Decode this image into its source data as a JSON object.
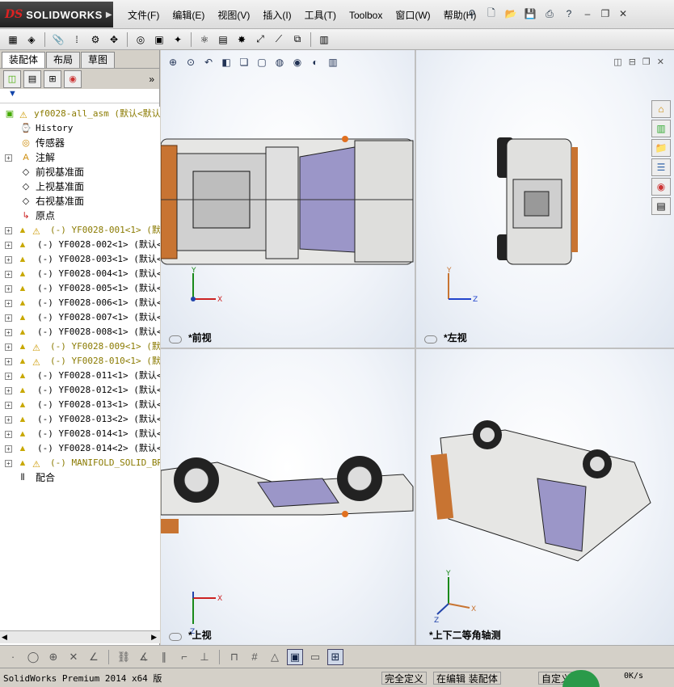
{
  "app": {
    "logo_prefix": "DS",
    "logo_name": "SOLIDWORKS"
  },
  "menu": [
    "文件(F)",
    "编辑(E)",
    "视图(V)",
    "插入(I)",
    "工具(T)",
    "Toolbox",
    "窗口(W)",
    "帮助(H)"
  ],
  "tabs": [
    "装配体",
    "布局",
    "草图"
  ],
  "tree": {
    "root": "yf0028-all_asm  (默认<默认",
    "items": [
      {
        "label": "History",
        "type": "folder"
      },
      {
        "label": "传感器",
        "type": "folder"
      },
      {
        "label": "注解",
        "type": "folder"
      },
      {
        "label": "前视基准面",
        "type": "plane"
      },
      {
        "label": "上视基准面",
        "type": "plane"
      },
      {
        "label": "右视基准面",
        "type": "plane"
      },
      {
        "label": "原点",
        "type": "origin"
      }
    ],
    "components": [
      {
        "label": "(-) YF0028-001<1> (默认",
        "warn": true
      },
      {
        "label": "(-) YF0028-002<1> (默认<<",
        "warn": false
      },
      {
        "label": "(-) YF0028-003<1> (默认<<",
        "warn": false
      },
      {
        "label": "(-) YF0028-004<1> (默认<<",
        "warn": false
      },
      {
        "label": "(-) YF0028-005<1> (默认<<",
        "warn": false
      },
      {
        "label": "(-) YF0028-006<1> (默认<<",
        "warn": false
      },
      {
        "label": "(-) YF0028-007<1> (默认<<",
        "warn": false
      },
      {
        "label": "(-) YF0028-008<1> (默认<<",
        "warn": false
      },
      {
        "label": "(-) YF0028-009<1> (默认",
        "warn": true
      },
      {
        "label": "(-) YF0028-010<1> (默认",
        "warn": true
      },
      {
        "label": "(-) YF0028-011<1> (默认<<",
        "warn": false
      },
      {
        "label": "(-) YF0028-012<1> (默认<<",
        "warn": false
      },
      {
        "label": "(-) YF0028-013<1> (默认<<",
        "warn": false
      },
      {
        "label": "(-) YF0028-013<2> (默认<<",
        "warn": false
      },
      {
        "label": "(-) YF0028-014<1> (默认<<",
        "warn": false
      },
      {
        "label": "(-) YF0028-014<2> (默认<<",
        "warn": false
      },
      {
        "label": "(-) MANIFOLD_SOLID_BREP",
        "warn": true
      }
    ],
    "mates": "配合"
  },
  "viewports": {
    "front": "*前视",
    "left": "*左视",
    "top": "*上视",
    "iso": "*上下二等角轴测"
  },
  "status": {
    "product": "SolidWorks Premium 2014 x64 版",
    "defined": "完全定义",
    "editing": "在编辑 装配体",
    "custom": "自定义",
    "net": "0K/s"
  },
  "colors": {
    "accent": "#1a3c8c",
    "warning": "#d8a800",
    "car_body": "#e8e8e6",
    "glass": "#9b96c8",
    "orange": "#c87432"
  }
}
